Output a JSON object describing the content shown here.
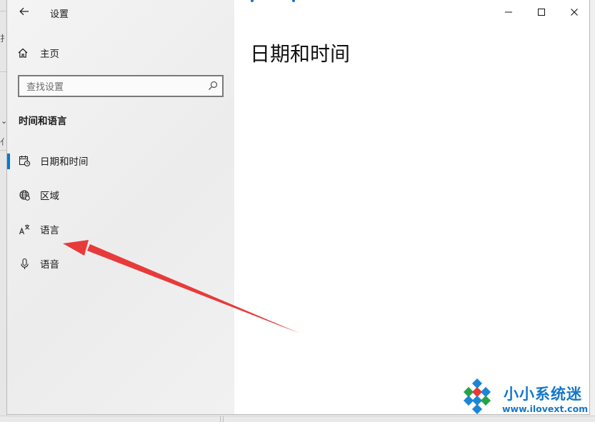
{
  "window": {
    "title": "设置"
  },
  "nav": {
    "home_label": "主页",
    "search_placeholder": "查找设置",
    "section_title": "时间和语言",
    "items": [
      {
        "label": "日期和时间",
        "icon": "calendar-clock-icon",
        "selected": true
      },
      {
        "label": "区域",
        "icon": "globe-icon",
        "selected": false
      },
      {
        "label": "语言",
        "icon": "language-icon",
        "selected": false
      },
      {
        "label": "语音",
        "icon": "microphone-icon",
        "selected": false
      }
    ]
  },
  "content": {
    "page_title": "日期和时间"
  },
  "watermark": {
    "brand": "小小系统迷",
    "url": "www.ilovext.com"
  },
  "colors": {
    "accent": "#0078d7",
    "arrow": "#e83a3a",
    "watermark": "#1477c8"
  }
}
